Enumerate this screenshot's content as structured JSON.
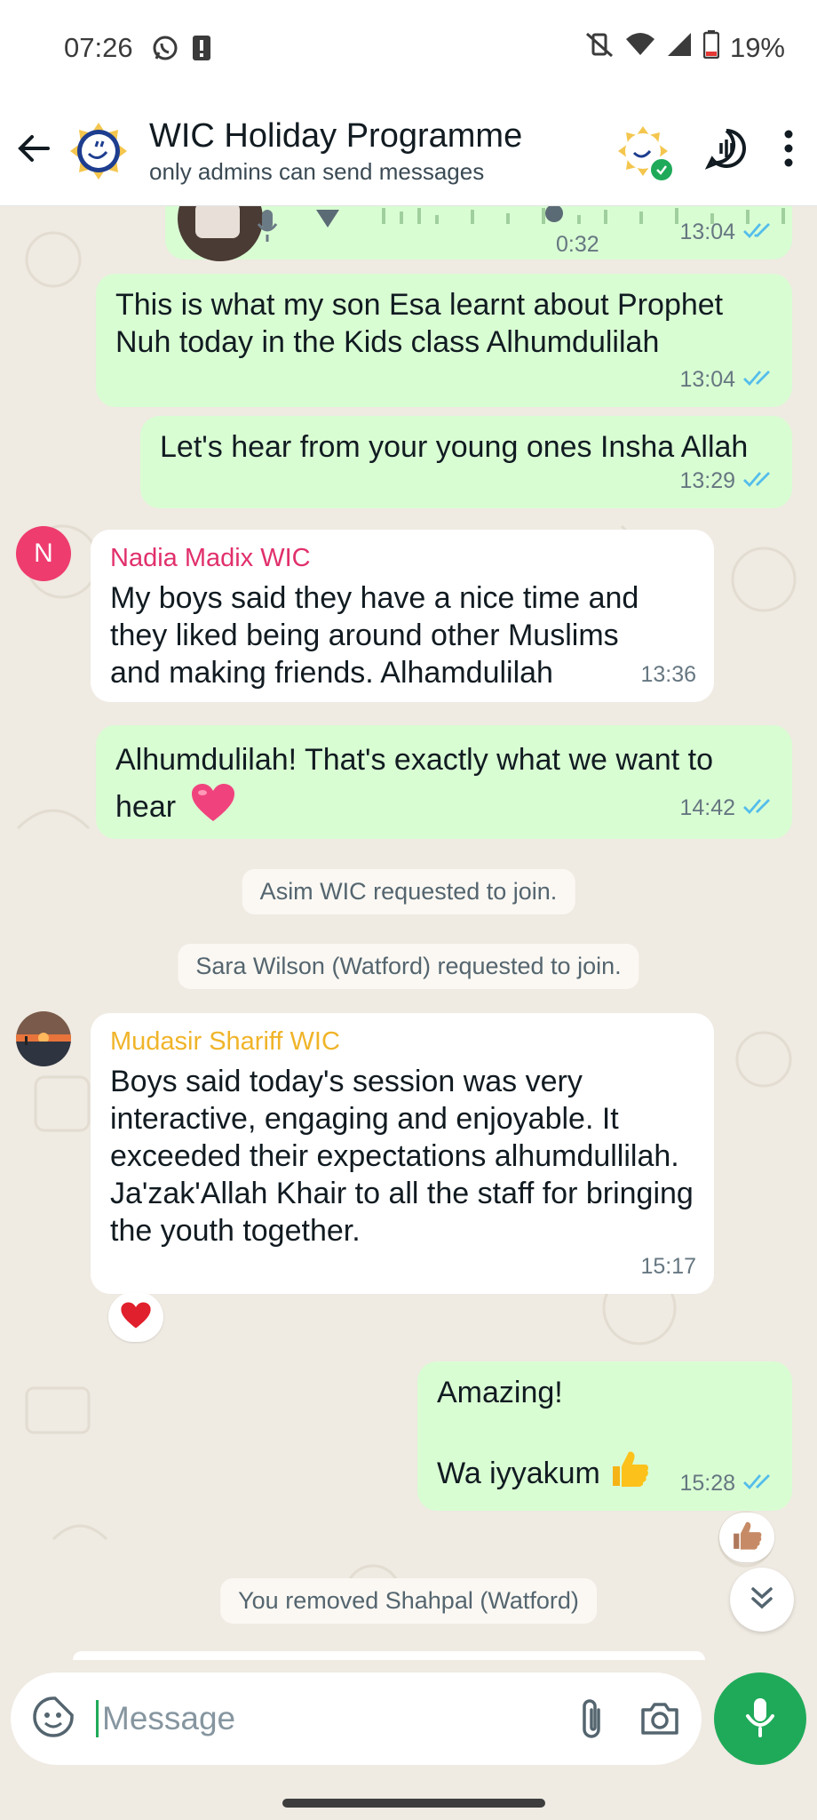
{
  "status_bar": {
    "time": "07:26",
    "battery": "19%"
  },
  "header": {
    "title": "WIC Holiday Programme",
    "subtitle": "only admins can send messages"
  },
  "voice_note": {
    "duration": "0:32",
    "time": "13:04"
  },
  "messages": [
    {
      "id": "m1",
      "direction": "out",
      "text": "This is what my son Esa learnt about Prophet Nuh today in the Kids class Alhumdulilah",
      "time": "13:04"
    },
    {
      "id": "m2",
      "direction": "out",
      "text": "Let's hear from your young ones Insha Allah",
      "time": "13:29"
    },
    {
      "id": "m3",
      "direction": "in",
      "sender": "Nadia Madix WIC",
      "avatar_letter": "N",
      "text": "My boys said they have a nice time and they liked being around other Muslims and making friends. Alhamdulilah",
      "time": "13:36"
    },
    {
      "id": "m4",
      "direction": "out",
      "text": "Alhumdulilah! That's exactly what we want to hear",
      "emoji": "heart-emoji",
      "time": "14:42"
    },
    {
      "id": "m5",
      "direction": "in",
      "sender": "Mudasir Shariff WIC",
      "text": "Boys said today's session was very interactive, engaging and enjoyable. It exceeded their expectations alhumdullilah. Ja'zak'Allah Khair to all the staff for bringing the youth together.",
      "time": "15:17",
      "reaction": "red-heart"
    },
    {
      "id": "m6",
      "direction": "out",
      "line1": "Amazing!",
      "line2": "Wa iyyakum",
      "emoji": "thumbs-up-emoji",
      "time": "15:28",
      "reaction": "thumbs-up-medium-skin"
    }
  ],
  "system_messages": {
    "s1": "Asim WIC requested to join.",
    "s2": "Sara Wilson (Watford) requested to join.",
    "s3": "You removed Shahpal (Watford)"
  },
  "colors": {
    "outgoing": "#d9fdd3",
    "incoming": "#ffffff",
    "accent": "#1faa59",
    "read_ticks": "#53bdeb",
    "sender_nadia": "#e1306c",
    "sender_mudasir": "#f0b429"
  },
  "composer": {
    "placeholder": "Message"
  }
}
